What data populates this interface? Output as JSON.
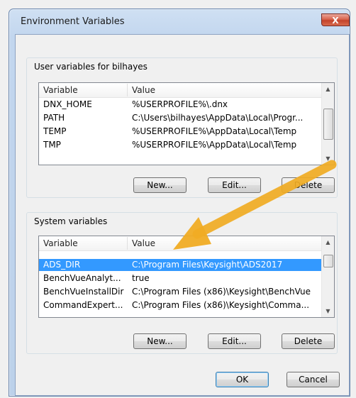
{
  "window": {
    "title": "Environment Variables",
    "close_label": "X"
  },
  "user": {
    "label": "User variables for bilhayes",
    "headers": {
      "variable": "Variable",
      "value": "Value"
    },
    "rows": [
      {
        "name": "DNX_HOME",
        "value": "%USERPROFILE%\\.dnx"
      },
      {
        "name": "PATH",
        "value": "C:\\Users\\bilhayes\\AppData\\Local\\Progr..."
      },
      {
        "name": "TEMP",
        "value": "%USERPROFILE%\\AppData\\Local\\Temp"
      },
      {
        "name": "TMP",
        "value": "%USERPROFILE%\\AppData\\Local\\Temp"
      }
    ],
    "buttons": {
      "new": "New...",
      "edit": "Edit...",
      "delete": "Delete"
    }
  },
  "system": {
    "label": "System variables",
    "headers": {
      "variable": "Variable",
      "value": "Value"
    },
    "rows": [
      {
        "name": "ADS_DIR",
        "value": "C:\\Program Files\\Keysight\\ADS2017",
        "selected": true
      },
      {
        "name": "BenchVueAnalyt...",
        "value": "true"
      },
      {
        "name": "BenchVueInstallDir",
        "value": "C:\\Program Files (x86)\\Keysight\\BenchVue"
      },
      {
        "name": "CommandExpert...",
        "value": "C:\\Program Files (x86)\\Keysight\\Comma..."
      }
    ],
    "buttons": {
      "new": "New...",
      "edit": "Edit...",
      "delete": "Delete"
    }
  },
  "footer": {
    "ok": "OK",
    "cancel": "Cancel"
  },
  "colors": {
    "arrow": "#f0ac24",
    "selection": "#3399ff"
  }
}
